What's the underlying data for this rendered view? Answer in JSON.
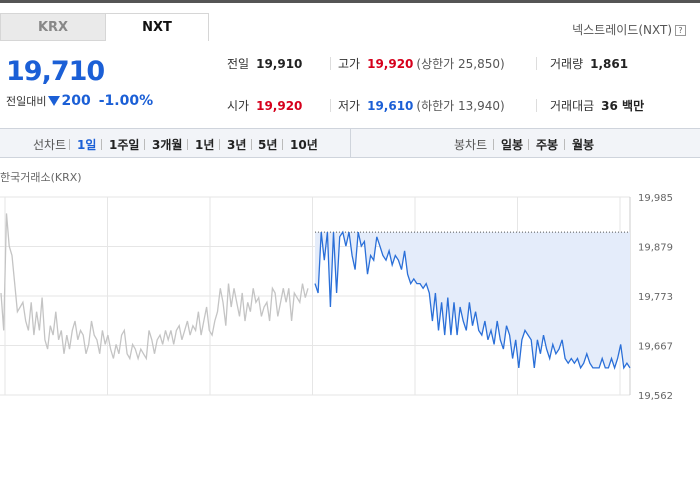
{
  "tabs": [
    {
      "label": "KRX",
      "active": false
    },
    {
      "label": "NXT",
      "active": true
    }
  ],
  "nxt_link": {
    "label": "넥스트레이드(NXT)",
    "help_icon": "question-mark-icon",
    "help_glyph": "?"
  },
  "price": {
    "current": "19,710",
    "change_label": "전일대비",
    "change_value": "200",
    "change_direction": "down",
    "change_pct": "-1.00%"
  },
  "stats": {
    "prev_close": {
      "label": "전일",
      "value": "19,910"
    },
    "high": {
      "label": "고가",
      "value": "19,920",
      "sub": "(상한가 25,850)"
    },
    "volume": {
      "label": "거래량",
      "value": "1,861"
    },
    "open": {
      "label": "시가",
      "value": "19,920"
    },
    "low": {
      "label": "저가",
      "value": "19,610",
      "sub": "(하한가 13,940)"
    },
    "amount": {
      "label": "거래대금",
      "value": "36 백만"
    }
  },
  "period_bar": {
    "line_label": "선차트",
    "line_periods": [
      "1일",
      "1주일",
      "3개월",
      "1년",
      "3년",
      "5년",
      "10년"
    ],
    "active_period": "1일",
    "candle_label": "봉차트",
    "candle_periods": [
      "일봉",
      "주봉",
      "월봉"
    ]
  },
  "chart_title": "한국거래소(KRX)",
  "colors": {
    "up": "#d6001c",
    "down": "#1b5fd6",
    "krx_line": "#c4c4c4",
    "nxt_line": "#2a6fd8",
    "nxt_fill": "#e4ecfa"
  },
  "chart_data": {
    "type": "line",
    "y_ticks": [
      "19,985",
      "19,879",
      "19,773",
      "19,667",
      "19,562"
    ],
    "ylim": [
      19562,
      19985
    ],
    "reference_value": 19910,
    "series": [
      {
        "values": [
          19780,
          19700,
          19950,
          19880,
          19860,
          19800,
          19740,
          19750,
          19760,
          19720,
          19700,
          19760,
          19690,
          19740,
          19700,
          19770,
          19680,
          19660,
          19710,
          19690,
          19740,
          19680,
          19700,
          19650,
          19690,
          19660,
          19700,
          19720,
          19680,
          19700,
          19690,
          19650,
          19670,
          19720,
          19690,
          19680,
          19650,
          19700,
          19670,
          19690,
          19660,
          19640,
          19670,
          19650,
          19690,
          19700,
          19650,
          19640,
          19670,
          19660,
          19640,
          19660,
          19650,
          19640,
          19700,
          19680,
          19650,
          19680,
          19690,
          19670,
          19700,
          19680,
          19700,
          19670,
          19700,
          19710,
          19680,
          19700,
          19720,
          19690,
          19710,
          19700,
          19740,
          19690,
          19720,
          19750,
          19700,
          19690,
          19720,
          19740,
          19790,
          19760,
          19710,
          19800,
          19750,
          19790,
          19760,
          19730,
          19780,
          19720,
          19760,
          19740,
          19790,
          19760,
          19770,
          19730,
          19750,
          19760,
          19720,
          19790,
          19780,
          19730,
          19760,
          19790,
          19760,
          19790,
          19720,
          19780,
          19770,
          19760,
          19800,
          19770,
          19790
        ]
      },
      {
        "values": [
          19800,
          19780,
          19910,
          19850,
          19910,
          19750,
          19910,
          19780,
          19900,
          19910,
          19880,
          19910,
          19860,
          19830,
          19910,
          19880,
          19890,
          19820,
          19860,
          19850,
          19900,
          19880,
          19860,
          19850,
          19870,
          19840,
          19860,
          19850,
          19830,
          19870,
          19820,
          19800,
          19810,
          19800,
          19800,
          19790,
          19800,
          19780,
          19720,
          19780,
          19700,
          19760,
          19690,
          19770,
          19690,
          19760,
          19690,
          19750,
          19720,
          19700,
          19760,
          19710,
          19740,
          19700,
          19690,
          19720,
          19680,
          19700,
          19670,
          19720,
          19680,
          19660,
          19710,
          19690,
          19640,
          19680,
          19620,
          19680,
          19700,
          19690,
          19680,
          19620,
          19680,
          19650,
          19690,
          19660,
          19640,
          19670,
          19650,
          19660,
          19680,
          19640,
          19630,
          19640,
          19630,
          19640,
          19620,
          19630,
          19650,
          19630,
          19620,
          19620,
          19620,
          19640,
          19620,
          19620,
          19640,
          19620,
          19640,
          19670,
          19620,
          19630,
          19620
        ]
      }
    ]
  }
}
